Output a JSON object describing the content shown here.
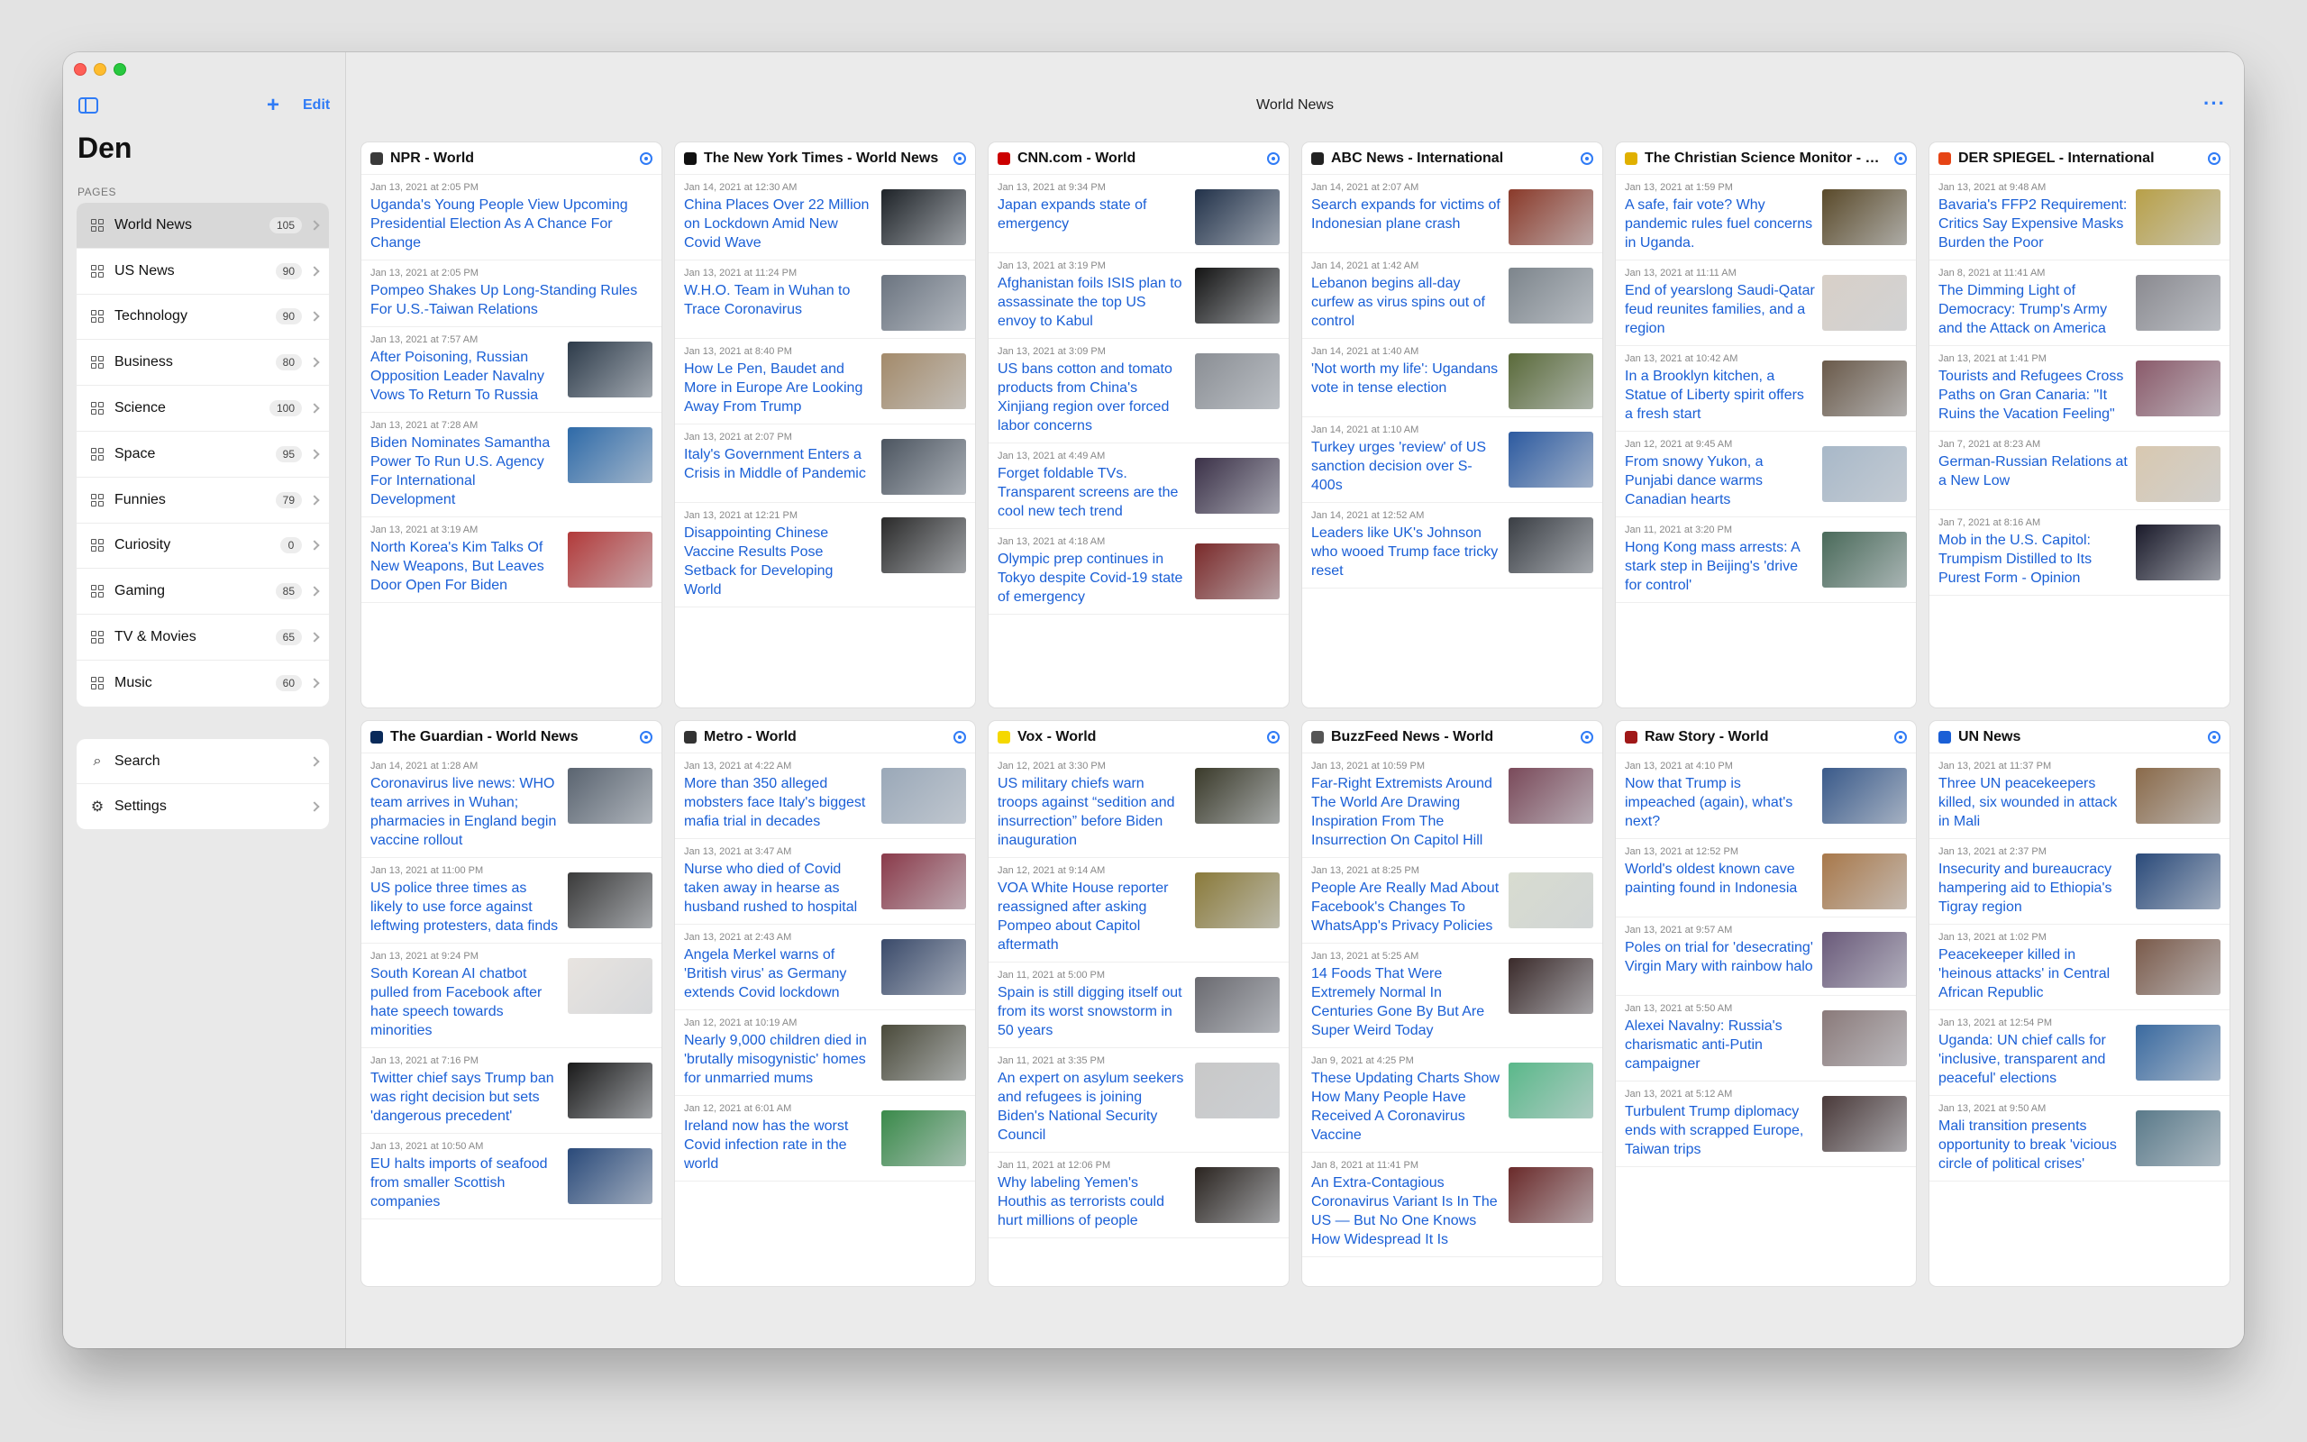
{
  "sidebar": {
    "add_label": "+",
    "edit_label": "Edit",
    "title": "Den",
    "section_label": "PAGES",
    "pages": [
      {
        "label": "World News",
        "count": "105"
      },
      {
        "label": "US News",
        "count": "90"
      },
      {
        "label": "Technology",
        "count": "90"
      },
      {
        "label": "Business",
        "count": "80"
      },
      {
        "label": "Science",
        "count": "100"
      },
      {
        "label": "Space",
        "count": "95"
      },
      {
        "label": "Funnies",
        "count": "79"
      },
      {
        "label": "Curiosity",
        "count": "0"
      },
      {
        "label": "Gaming",
        "count": "85"
      },
      {
        "label": "TV & Movies",
        "count": "65"
      },
      {
        "label": "Music",
        "count": "60"
      }
    ],
    "tools": [
      {
        "label": "Search",
        "icon": "search-icon"
      },
      {
        "label": "Settings",
        "icon": "gear-icon"
      }
    ]
  },
  "main": {
    "title": "World News",
    "more_label": "···"
  },
  "feeds": [
    {
      "title": "NPR - World",
      "icon_color": "#3a3a3a",
      "articles": [
        {
          "date": "Jan 13, 2021 at 2:05 PM",
          "title": "Uganda's Young People View Upcoming Presidential Election As A Chance For Change",
          "thumb": null
        },
        {
          "date": "Jan 13, 2021 at 2:05 PM",
          "title": "Pompeo Shakes Up Long-Standing Rules For U.S.-Taiwan Relations",
          "thumb": null
        },
        {
          "date": "Jan 13, 2021 at 7:57 AM",
          "title": "After Poisoning, Russian Opposition Leader Navalny Vows To Return To Russia",
          "thumb": "#2d3b4a"
        },
        {
          "date": "Jan 13, 2021 at 7:28 AM",
          "title": "Biden Nominates Samantha Power To Run U.S. Agency For International Development",
          "thumb": "#2e6aa8"
        },
        {
          "date": "Jan 13, 2021 at 3:19 AM",
          "title": "North Korea's Kim Talks Of New Weapons, But Leaves Door Open For Biden",
          "thumb": "#b23a3a"
        }
      ]
    },
    {
      "title": "The New York Times - World News",
      "icon_color": "#111111",
      "articles": [
        {
          "date": "Jan 14, 2021 at 12:30 AM",
          "title": "China Places Over 22 Million on Lockdown Amid New Covid Wave",
          "thumb": "#1e2328"
        },
        {
          "date": "Jan 13, 2021 at 11:24 PM",
          "title": "W.H.O. Team in Wuhan to Trace Coronavirus",
          "thumb": "#6b7480"
        },
        {
          "date": "Jan 13, 2021 at 8:40 PM",
          "title": "How Le Pen, Baudet and More in Europe Are Looking Away From Trump",
          "thumb": "#a38a6a"
        },
        {
          "date": "Jan 13, 2021 at 2:07 PM",
          "title": "Italy's Government Enters a Crisis in Middle of Pandemic",
          "thumb": "#4c5560"
        },
        {
          "date": "Jan 13, 2021 at 12:21 PM",
          "title": "Disappointing Chinese Vaccine Results Pose Setback for Developing World",
          "thumb": "#2a2a2a"
        }
      ]
    },
    {
      "title": "CNN.com - World",
      "icon_color": "#cc0000",
      "articles": [
        {
          "date": "Jan 13, 2021 at 9:34 PM",
          "title": "Japan expands state of emergency",
          "thumb": "#22324a"
        },
        {
          "date": "Jan 13, 2021 at 3:19 PM",
          "title": "Afghanistan foils ISIS plan to assassinate the top US envoy to Kabul",
          "thumb": "#141414"
        },
        {
          "date": "Jan 13, 2021 at 3:09 PM",
          "title": "US bans cotton and tomato products from China's Xinjiang region over forced labor concerns",
          "thumb": "#8a8e94"
        },
        {
          "date": "Jan 13, 2021 at 4:49 AM",
          "title": "Forget foldable TVs. Transparent screens are the cool new tech trend",
          "thumb": "#3b3148"
        },
        {
          "date": "Jan 13, 2021 at 4:18 AM",
          "title": "Olympic prep continues in Tokyo despite Covid-19 state of emergency",
          "thumb": "#7a2a2a"
        }
      ]
    },
    {
      "title": "ABC News - International",
      "icon_color": "#222222",
      "articles": [
        {
          "date": "Jan 14, 2021 at 2:07 AM",
          "title": "Search expands for victims of Indonesian plane crash",
          "thumb": "#8a3a2a"
        },
        {
          "date": "Jan 14, 2021 at 1:42 AM",
          "title": "Lebanon begins all-day curfew as virus spins out of control",
          "thumb": "#7d858c"
        },
        {
          "date": "Jan 14, 2021 at 1:40 AM",
          "title": "'Not worth my life': Ugandans vote in tense election",
          "thumb": "#5a6a3a"
        },
        {
          "date": "Jan 14, 2021 at 1:10 AM",
          "title": "Turkey urges 'review' of US sanction decision over S-400s",
          "thumb": "#2c5aa0"
        },
        {
          "date": "Jan 14, 2021 at 12:52 AM",
          "title": "Leaders like UK's Johnson who wooed Trump face tricky reset",
          "thumb": "#3a3e44"
        }
      ]
    },
    {
      "title": "The Christian Science Monitor - World",
      "icon_color": "#e0b000",
      "articles": [
        {
          "date": "Jan 13, 2021 at 1:59 PM",
          "title": "A safe, fair vote? Why pandemic rules fuel concerns in Uganda.",
          "thumb": "#5a4a2a"
        },
        {
          "date": "Jan 13, 2021 at 11:11 AM",
          "title": "End of yearslong Saudi-Qatar feud reunites families, and a region",
          "thumb": "#d8d0c8"
        },
        {
          "date": "Jan 13, 2021 at 10:42 AM",
          "title": "In a Brooklyn kitchen, a Statue of Liberty spirit offers a fresh start",
          "thumb": "#6a5a4a"
        },
        {
          "date": "Jan 12, 2021 at 9:45 AM",
          "title": "From snowy Yukon, a Punjabi dance warms Canadian hearts",
          "thumb": "#a8b8c8"
        },
        {
          "date": "Jan 11, 2021 at 3:20 PM",
          "title": "Hong Kong mass arrests: A stark step in Beijing's 'drive for control'",
          "thumb": "#4a6a5a"
        }
      ]
    },
    {
      "title": "DER SPIEGEL - International",
      "icon_color": "#e64415",
      "articles": [
        {
          "date": "Jan 13, 2021 at 9:48 AM",
          "title": "Bavaria's FFP2 Requirement: Critics Say Expensive Masks Burden the Poor",
          "thumb": "#b8a048"
        },
        {
          "date": "Jan 8, 2021 at 11:41 AM",
          "title": "The Dimming Light of Democracy: Trump's Army and the Attack on America",
          "thumb": "#8a8a90"
        },
        {
          "date": "Jan 13, 2021 at 1:41 PM",
          "title": "Tourists and Refugees Cross Paths on Gran Canaria: \"It Ruins the Vacation Feeling\"",
          "thumb": "#8a5a6a"
        },
        {
          "date": "Jan 7, 2021 at 8:23 AM",
          "title": "German-Russian Relations at a New Low",
          "thumb": "#d8c8b0"
        },
        {
          "date": "Jan 7, 2021 at 8:16 AM",
          "title": "Mob in the U.S. Capitol: Trumpism Distilled to Its Purest Form - Opinion",
          "thumb": "#1a1a2a"
        }
      ]
    },
    {
      "title": "The Guardian - World News",
      "icon_color": "#0a2a5a",
      "articles": [
        {
          "date": "Jan 14, 2021 at 1:28 AM",
          "title": "Coronavirus live news: WHO team arrives in Wuhan; pharmacies in England begin vaccine rollout",
          "thumb": "#5a6470"
        },
        {
          "date": "Jan 13, 2021 at 11:00 PM",
          "title": "US police three times as likely to use force against leftwing protesters, data finds",
          "thumb": "#3a3a3a"
        },
        {
          "date": "Jan 13, 2021 at 9:24 PM",
          "title": "South Korean AI chatbot pulled from Facebook after hate speech towards minorities",
          "thumb": "#e8e4e0"
        },
        {
          "date": "Jan 13, 2021 at 7:16 PM",
          "title": "Twitter chief says Trump ban was right decision but sets 'dangerous precedent'",
          "thumb": "#1a1a1a"
        },
        {
          "date": "Jan 13, 2021 at 10:50 AM",
          "title": "EU halts imports of seafood from smaller Scottish companies",
          "thumb": "#2a4a7a"
        }
      ]
    },
    {
      "title": "Metro - World",
      "icon_color": "#333333",
      "articles": [
        {
          "date": "Jan 13, 2021 at 4:22 AM",
          "title": "More than 350 alleged mobsters face Italy's biggest mafia trial in decades",
          "thumb": "#9aa8b8"
        },
        {
          "date": "Jan 13, 2021 at 3:47 AM",
          "title": "Nurse who died of Covid taken away in hearse as husband rushed to hospital",
          "thumb": "#8a3a4a"
        },
        {
          "date": "Jan 13, 2021 at 2:43 AM",
          "title": "Angela Merkel warns of 'British virus' as Germany extends Covid lockdown",
          "thumb": "#3a4a6a"
        },
        {
          "date": "Jan 12, 2021 at 10:19 AM",
          "title": "Nearly 9,000 children died in 'brutally misogynistic' homes for unmarried mums",
          "thumb": "#4a4a3a"
        },
        {
          "date": "Jan 12, 2021 at 6:01 AM",
          "title": "Ireland now has the worst Covid infection rate in the world",
          "thumb": "#3a8a4a"
        }
      ]
    },
    {
      "title": "Vox -  World",
      "icon_color": "#f5d800",
      "articles": [
        {
          "date": "Jan 12, 2021 at 3:30 PM",
          "title": "US military chiefs warn troops against “sedition and insurrection” before Biden inauguration",
          "thumb": "#3a3a2a"
        },
        {
          "date": "Jan 12, 2021 at 9:14 AM",
          "title": "VOA White House reporter reassigned after asking Pompeo about Capitol aftermath",
          "thumb": "#8a7a3a"
        },
        {
          "date": "Jan 11, 2021 at 5:00 PM",
          "title": "Spain is still digging itself out from its worst snowstorm in 50 years",
          "thumb": "#6a6a70"
        },
        {
          "date": "Jan 11, 2021 at 3:35 PM",
          "title": "An expert on asylum seekers and refugees is joining Biden's National Security Council",
          "thumb": "#c8c8c8"
        },
        {
          "date": "Jan 11, 2021 at 12:06 PM",
          "title": "Why labeling Yemen's Houthis as terrorists could hurt millions of people",
          "thumb": "#2a2420"
        }
      ]
    },
    {
      "title": "BuzzFeed News - World",
      "icon_color": "#555555",
      "articles": [
        {
          "date": "Jan 13, 2021 at 10:59 PM",
          "title": "Far-Right Extremists Around The World Are Drawing Inspiration From The Insurrection On Capitol Hill",
          "thumb": "#7a4a5a"
        },
        {
          "date": "Jan 13, 2021 at 8:25 PM",
          "title": "People Are Really Mad About Facebook's Changes To WhatsApp's Privacy Policies",
          "thumb": "#d8dcd0"
        },
        {
          "date": "Jan 13, 2021 at 5:25 AM",
          "title": "14 Foods That Were Extremely Normal In Centuries Gone By But Are Super Weird Today",
          "thumb": "#3a2a2a"
        },
        {
          "date": "Jan 9, 2021 at 4:25 PM",
          "title": "These Updating Charts Show How Many People Have Received A Coronavirus Vaccine",
          "thumb": "#5ab88a"
        },
        {
          "date": "Jan 8, 2021 at 11:41 PM",
          "title": "An Extra-Contagious Coronavirus Variant Is In The US — But No One Knows How Widespread It Is",
          "thumb": "#6a2a2a"
        }
      ]
    },
    {
      "title": "Raw Story - World",
      "icon_color": "#a01818",
      "articles": [
        {
          "date": "Jan 13, 2021 at 4:10 PM",
          "title": "Now that Trump is impeached (again), what's next?",
          "thumb": "#3a5a8a"
        },
        {
          "date": "Jan 13, 2021 at 12:52 PM",
          "title": "World's oldest known cave painting found in Indonesia",
          "thumb": "#a8784a"
        },
        {
          "date": "Jan 13, 2021 at 9:57 AM",
          "title": "Poles on trial for 'desecrating' Virgin Mary with rainbow halo",
          "thumb": "#6a5a7a"
        },
        {
          "date": "Jan 13, 2021 at 5:50 AM",
          "title": "Alexei Navalny: Russia's charismatic anti-Putin campaigner",
          "thumb": "#8a7a7a"
        },
        {
          "date": "Jan 13, 2021 at 5:12 AM",
          "title": "Turbulent Trump diplomacy ends with scrapped Europe, Taiwan trips",
          "thumb": "#4a3a3a"
        }
      ]
    },
    {
      "title": "UN News",
      "icon_color": "#1a5fd6",
      "articles": [
        {
          "date": "Jan 13, 2021 at 11:37 PM",
          "title": "Three UN peacekeepers killed, six wounded in attack in Mali",
          "thumb": "#8a6a4a"
        },
        {
          "date": "Jan 13, 2021 at 2:37 PM",
          "title": "Insecurity and bureaucracy hampering aid to Ethiopia's Tigray region",
          "thumb": "#2a4a7a"
        },
        {
          "date": "Jan 13, 2021 at 1:02 PM",
          "title": "Peacekeeper killed in 'heinous attacks' in Central African Republic",
          "thumb": "#7a5a4a"
        },
        {
          "date": "Jan 13, 2021 at 12:54 PM",
          "title": "Uganda: UN chief calls for 'inclusive, transparent and peaceful' elections",
          "thumb": "#3a6aa0"
        },
        {
          "date": "Jan 13, 2021 at 9:50 AM",
          "title": "Mali transition presents opportunity to break 'vicious circle of political crises'",
          "thumb": "#5a7a8a"
        }
      ]
    }
  ]
}
